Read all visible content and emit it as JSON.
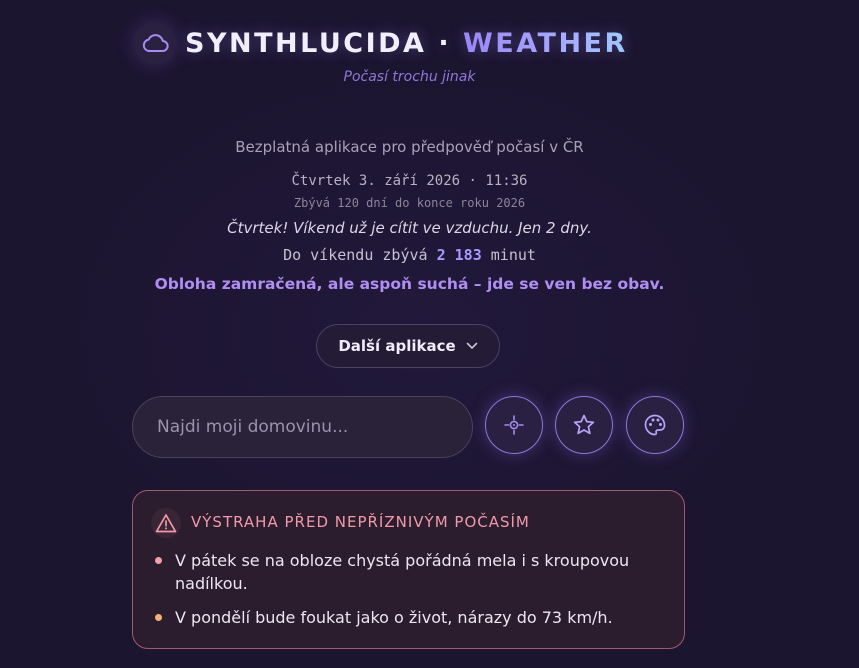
{
  "header": {
    "title_main": "SYNTHLUCIDA · ",
    "title_accent": "WEATHER",
    "tagline": "Počasí trochu jinak",
    "logo_icon": "cloud-icon"
  },
  "info": {
    "description": "Bezplatná aplikace pro předpověď počasí v ČR",
    "datetime": "Čtvrtek 3. září 2026 · 11:36",
    "year_remaining": "Zbývá 120 dní do konce roku 2026",
    "weekday_message": "Čtvrtek! Víkend už je cítit ve vzduchu. Jen 2 dny.",
    "weekend_prefix": "Do víkendu zbývá ",
    "weekend_minutes": "2 183",
    "weekend_suffix": " minut",
    "sky_message": "Obloha zamračená, ale aspoň suchá – jde se ven bez obav."
  },
  "more_apps": {
    "label": "Další aplikace",
    "icon": "chevron-down-icon"
  },
  "search": {
    "placeholder": "Najdi moji domovinu...",
    "value": ""
  },
  "actions": {
    "locate_icon": "location-crosshair-icon",
    "favorite_icon": "star-icon",
    "theme_icon": "palette-icon"
  },
  "alert": {
    "icon": "warning-triangle-icon",
    "title": "VÝSTRAHA PŘED NEPŘÍZNIVÝM POČASÍM",
    "items": [
      {
        "text": "V pátek se na obloze chystá pořádná mela i s kroupovou nadílkou.",
        "color": "#f0a0a8"
      },
      {
        "text": "V pondělí bude foukat jako o život, nárazy do 73 km/h.",
        "color": "#f4b27a"
      }
    ]
  },
  "colors": {
    "background": "#1c1530",
    "accent": "#a898ff",
    "alert_border": "#a05a6e",
    "alert_title": "#f09aa8"
  }
}
